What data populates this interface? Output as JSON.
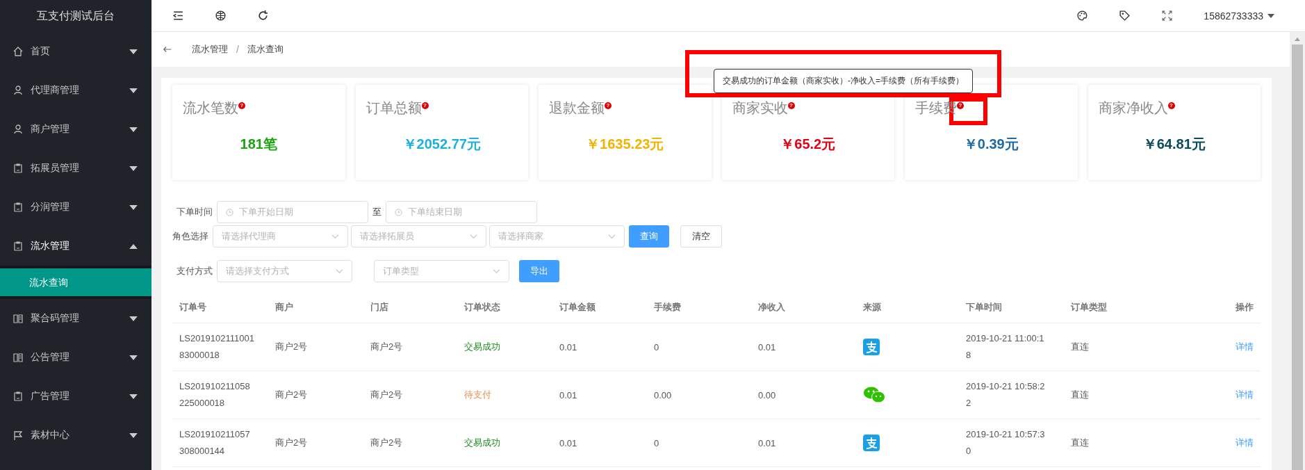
{
  "sidebar": {
    "title": "互支付测试后台",
    "items": [
      {
        "label": "首页",
        "expanded": false
      },
      {
        "label": "代理商管理",
        "expanded": false
      },
      {
        "label": "商户管理",
        "expanded": false
      },
      {
        "label": "拓展员管理",
        "expanded": false
      },
      {
        "label": "分润管理",
        "expanded": false
      },
      {
        "label": "流水管理",
        "expanded": true,
        "children": [
          {
            "label": "流水查询",
            "selected": true
          }
        ]
      },
      {
        "label": "聚合码管理",
        "expanded": false
      },
      {
        "label": "公告管理",
        "expanded": false
      },
      {
        "label": "广告管理",
        "expanded": false
      },
      {
        "label": "素材中心",
        "expanded": false
      }
    ]
  },
  "topbar": {
    "user": "15862733333"
  },
  "breadcrumb": {
    "separator": "/",
    "items": [
      "流水管理",
      "流水查询"
    ]
  },
  "tooltip": "交易成功的订单金额（商家实收）-净收入=手续费（所有手续费）",
  "cards": [
    {
      "title": "流水笔数",
      "help": "?",
      "value": "181笔",
      "color": "#1aa30f"
    },
    {
      "title": "订单总额",
      "help": "?",
      "value": "￥2052.77元",
      "color": "#1ab1e0"
    },
    {
      "title": "退款金额",
      "help": "?",
      "value": "￥1635.23元",
      "color": "#f2b400"
    },
    {
      "title": "商家实收",
      "help": "?",
      "value": "￥65.2元",
      "color": "#e60012"
    },
    {
      "title": "手续费",
      "help": "?",
      "value": "￥0.39元",
      "color": "#1d6aa5"
    },
    {
      "title": "商家净收入",
      "help": "?",
      "value": "￥64.81元",
      "color": "#0b4a5a"
    }
  ],
  "filters": {
    "time_label": "下单时间",
    "start_placeholder": "下单开始日期",
    "to": "至",
    "end_placeholder": "下单结束日期",
    "role_label": "角色选择",
    "agent_placeholder": "请选择代理商",
    "expander_placeholder": "请选择拓展员",
    "merchant_placeholder": "请选择商家",
    "query": "查询",
    "clear": "清空",
    "pay_label": "支付方式",
    "pay_placeholder": "请选择支付方式",
    "type_placeholder": "订单类型",
    "export": "导出"
  },
  "table": {
    "columns": [
      "订单号",
      "商户",
      "门店",
      "订单状态",
      "订单金额",
      "手续费",
      "净收入",
      "来源",
      "下单时间",
      "订单类型",
      "操作"
    ],
    "rows": [
      {
        "order_no": "LS2019102111001 83000018",
        "merchant": "商户2号",
        "store": "商户2号",
        "status": {
          "text": "交易成功",
          "kind": "success"
        },
        "amount": "0.01",
        "fee": "0",
        "net": "0.01",
        "source": {
          "kind": "alipay"
        },
        "time": "2019-10-21 11:00:18",
        "type": "直连",
        "action": "详情"
      },
      {
        "order_no": "LS201910211058 225000018",
        "merchant": "商户2号",
        "store": "商户2号",
        "status": {
          "text": "待支付",
          "kind": "pending"
        },
        "amount": "0.01",
        "fee": "0.00",
        "net": "0.00",
        "source": {
          "kind": "wechat"
        },
        "time": "2019-10-21 10:58:22",
        "type": "直连",
        "action": "详情"
      },
      {
        "order_no": "LS201910211057 308000144",
        "merchant": "商户2号",
        "store": "商户2号",
        "status": {
          "text": "交易成功",
          "kind": "success"
        },
        "amount": "0.01",
        "fee": "0",
        "net": "0.01",
        "source": {
          "kind": "alipay"
        },
        "time": "2019-10-21 10:57:30",
        "type": "直连",
        "action": "详情"
      }
    ]
  }
}
